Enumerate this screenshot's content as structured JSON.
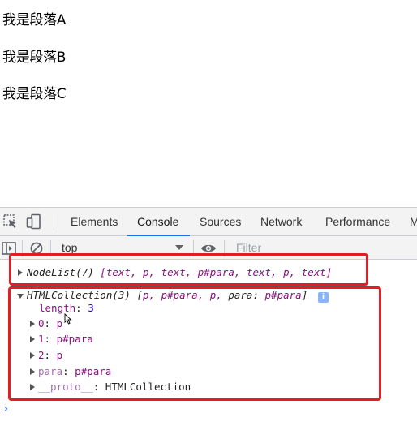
{
  "page": {
    "paragraphs": [
      "我是段落A",
      "我是段落B",
      "我是段落C"
    ]
  },
  "devtools": {
    "tabs": [
      "Elements",
      "Console",
      "Sources",
      "Network",
      "Performance",
      "M"
    ],
    "active_tab": "Console",
    "toolbar": {
      "context": "top",
      "filter_placeholder": "Filter"
    },
    "console": {
      "nodelist": {
        "summary": "NodeList(7)",
        "items": "[text, p, text, p#para, text, p, text]"
      },
      "htmlcollection": {
        "summary": "HTMLCollection(3)",
        "open_bracket": "[",
        "preview_items": "p, p#para, p, ",
        "preview_key": "para",
        "preview_val": "p#para",
        "close_bracket": "]",
        "info_badge": "i",
        "props": [
          {
            "key": "length",
            "sep": ": ",
            "value": "3"
          },
          {
            "key": "0",
            "sep": ": ",
            "value": "p"
          },
          {
            "key": "1",
            "sep": ": ",
            "value": "p#para"
          },
          {
            "key": "2",
            "sep": ": ",
            "value": "p"
          },
          {
            "key": "para",
            "sep": ": ",
            "value": "p#para"
          },
          {
            "key": "__proto__",
            "sep": ": ",
            "value": "HTMLCollection"
          }
        ]
      },
      "prompt": "›"
    }
  },
  "colors": {
    "highlight": "#e51c23",
    "accent": "#1a73e8"
  }
}
